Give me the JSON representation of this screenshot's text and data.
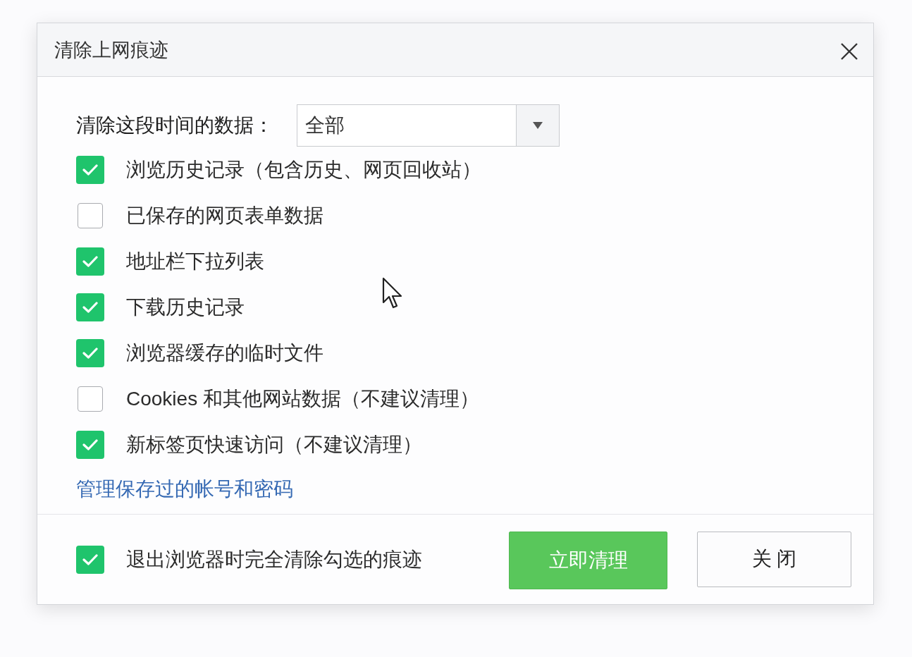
{
  "dialog": {
    "title": "清除上网痕迹"
  },
  "time_range": {
    "label": "清除这段时间的数据：",
    "value": "全部"
  },
  "options": [
    {
      "label": "浏览历史记录（包含历史、网页回收站）",
      "checked": true
    },
    {
      "label": "已保存的网页表单数据",
      "checked": false
    },
    {
      "label": "地址栏下拉列表",
      "checked": true
    },
    {
      "label": "下载历史记录",
      "checked": true
    },
    {
      "label": "浏览器缓存的临时文件",
      "checked": true
    },
    {
      "label": "Cookies 和其他网站数据（不建议清理）",
      "checked": false
    },
    {
      "label": "新标签页快速访问（不建议清理）",
      "checked": true
    }
  ],
  "manage_link": "管理保存过的帐号和密码",
  "footer": {
    "clear_on_exit": {
      "label": "退出浏览器时完全清除勾选的痕迹",
      "checked": true
    },
    "buttons": [
      {
        "label": "立即清理",
        "kind": "primary"
      },
      {
        "label": "关 闭",
        "kind": "secondary"
      }
    ]
  }
}
